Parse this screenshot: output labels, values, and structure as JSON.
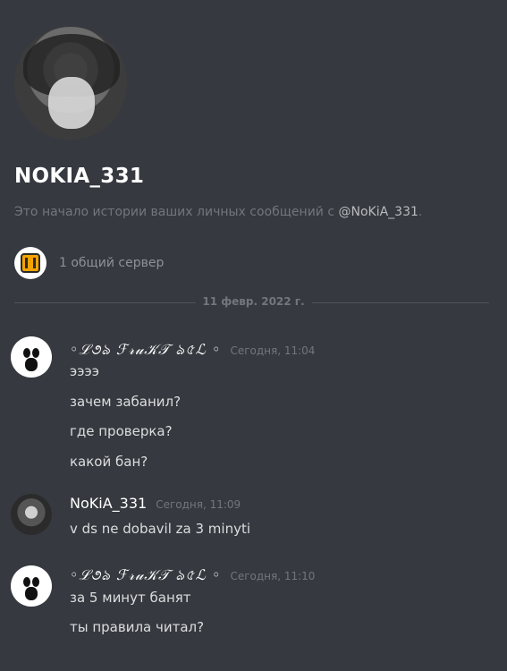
{
  "dm": {
    "username": "NOKIA_331",
    "intro_prefix": "Это начало истории ваших личных сообщений с ",
    "intro_mention": "@NoKiA_331",
    "intro_suffix": ".",
    "mutual_servers": "1 общий сервер",
    "date_divider": "11 февр. 2022 г."
  },
  "messages": [
    {
      "author": "◦ℒ૭ঌ ℱ𝓇𝓊𝒦𝒯 ঌ৫ℒ ◦",
      "time": "Сегодня, 11:04",
      "lines": [
        "ээээ",
        "зачем забанил?",
        "где проверка?",
        "какой бан?"
      ]
    },
    {
      "author": "NoKiA_331",
      "time": "Сегодня, 11:09",
      "lines": [
        "v ds ne dobavil za 3 minyti"
      ]
    },
    {
      "author": "◦ℒ૭ঌ ℱ𝓇𝓊𝒦𝒯 ঌ৫ℒ ◦",
      "time": "Сегодня, 11:10",
      "lines": [
        "за 5 минут банят",
        "ты правила читал?"
      ]
    }
  ],
  "icons": {
    "profile_avatar": "anime-avatar",
    "ghost_avatar": "ghost-avatar",
    "server_icon": "server-icon"
  },
  "colors": {
    "background": "#36393f",
    "username": "#ffffff",
    "muted": "#72767d",
    "message_text": "#dcddde"
  }
}
